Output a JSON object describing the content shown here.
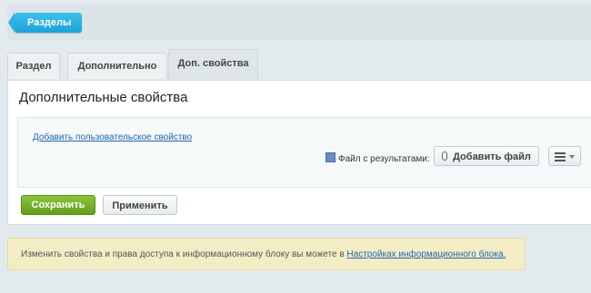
{
  "header": {
    "back_label": "Разделы"
  },
  "tabs": [
    {
      "label": "Раздел"
    },
    {
      "label": "Дополнительно"
    },
    {
      "label": "Доп. свойства",
      "active": true
    }
  ],
  "panel": {
    "title": "Дополнительные свойства",
    "add_property_link": "Добавить пользовательское свойство",
    "file_field_label": "Файл с результатами:",
    "add_file_button": "Добавить файл"
  },
  "actions": {
    "save_label": "Сохранить",
    "apply_label": "Применить"
  },
  "notice": {
    "text": "Изменить свойства и права доступа к информационному блоку вы можете в ",
    "link_text": "Настройках информационного блока."
  },
  "colors": {
    "accent_blue": "#1ba2d8",
    "save_green": "#5e9f1a",
    "link": "#2067b0",
    "notice_bg": "#f3edc6"
  }
}
